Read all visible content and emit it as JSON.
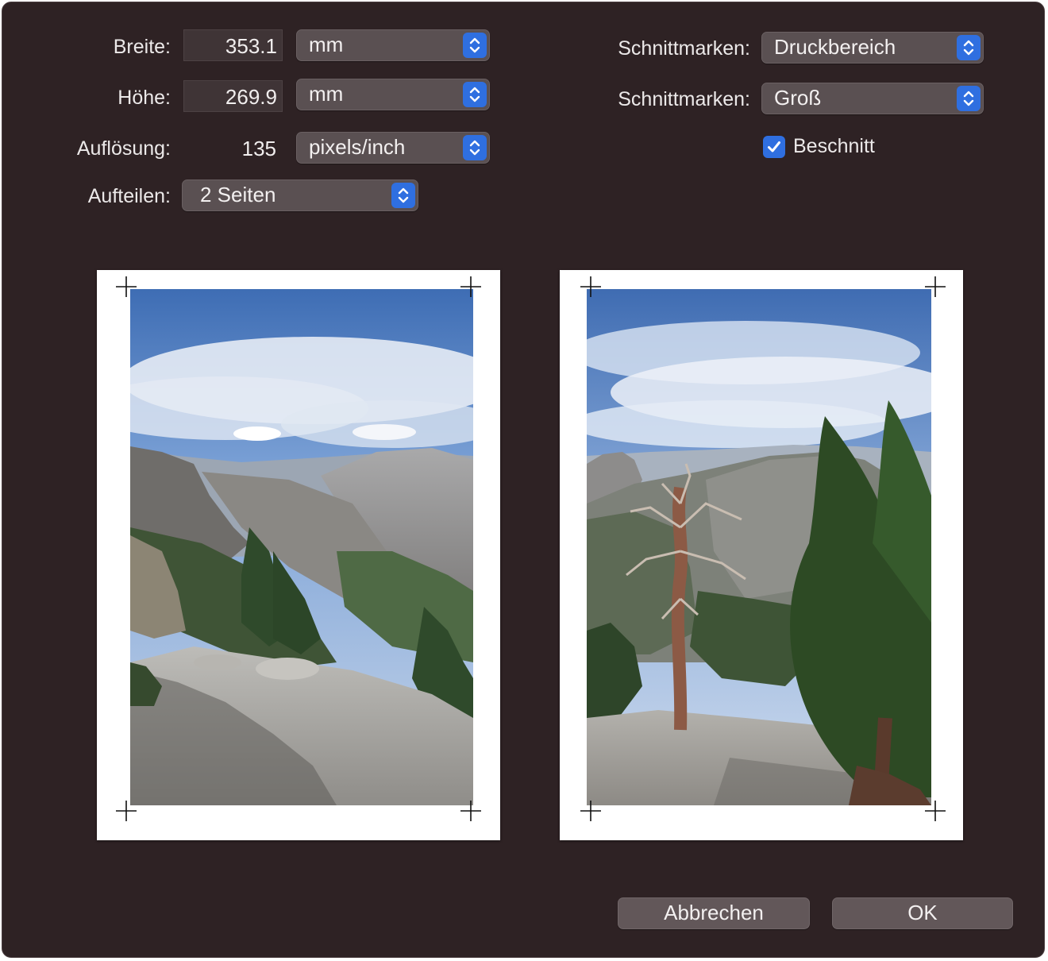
{
  "left_panel": {
    "width_label": "Breite:",
    "width_value": "353.1",
    "width_unit": "mm",
    "height_label": "Höhe:",
    "height_value": "269.9",
    "height_unit": "mm",
    "resolution_label": "Auflösung:",
    "resolution_value": "135",
    "resolution_unit": "pixels/inch",
    "split_label": "Aufteilen:",
    "split_value": "2 Seiten"
  },
  "right_panel": {
    "crop_marks_label_1": "Schnittmarken:",
    "crop_marks_value_1": "Druckbereich",
    "crop_marks_label_2": "Schnittmarken:",
    "crop_marks_value_2": "Groß",
    "bleed_label": "Beschnitt",
    "bleed_checked": true
  },
  "preview": {
    "pages": [
      {
        "name": "left-page",
        "subject": "mountain valley with granite slope"
      },
      {
        "name": "right-page",
        "subject": "dead tree and pine tree above valley"
      }
    ]
  },
  "buttons": {
    "cancel": "Abbrechen",
    "ok": "OK"
  },
  "colors": {
    "background": "#2e2224",
    "accent": "#2f6fe0"
  },
  "icons": [
    "up-down-stepper-icon",
    "checkmark-icon",
    "crop-mark-icon"
  ]
}
